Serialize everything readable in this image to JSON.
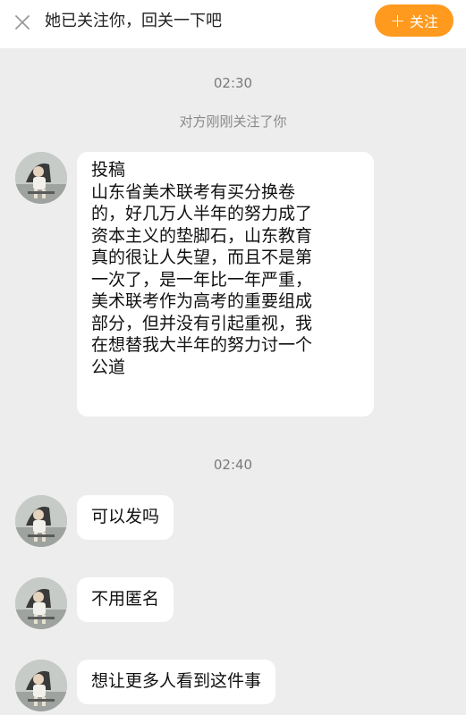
{
  "header": {
    "prompt_text": "她已关注你，回关一下吧",
    "follow_button_label": "+ 关注",
    "follow_button_text": "关注",
    "follow_button_icon": "plus-icon",
    "close_icon": "close-icon",
    "accent_color": "#ff9a1f"
  },
  "chat": {
    "timestamps": [
      "02:30",
      "02:40"
    ],
    "system_message": "对方刚刚关注了你",
    "messages": [
      {
        "lines": [
          "投稿",
          "山东省美术联考有买分换卷",
          "的，好几万人半年的努力成了",
          "资本主义的垫脚石，山东教育",
          "真的很让人失望，而且不是第",
          "一次了，是一年比一年严重，",
          "美术联考作为高考的重要组成",
          "部分，但并没有引起重视，我",
          "在想替我大半年的努力讨一个",
          "公道"
        ]
      },
      {
        "text": "可以发吗"
      },
      {
        "text": "不用匿名"
      },
      {
        "text": "想让更多人看到这件事"
      }
    ]
  }
}
